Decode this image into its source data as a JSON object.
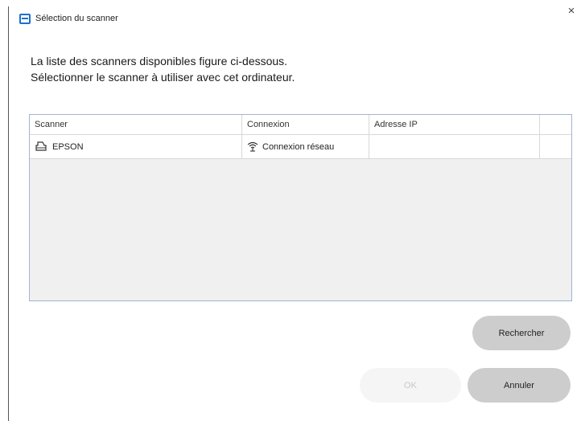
{
  "window": {
    "title": "Sélection du scanner",
    "close_glyph": "×"
  },
  "instructions": {
    "line1": "La liste des scanners disponibles figure ci-dessous.",
    "line2": "Sélectionner le scanner à utiliser avec cet ordinateur."
  },
  "table": {
    "headers": {
      "scanner": "Scanner",
      "connection": "Connexion",
      "ip": "Adresse IP"
    },
    "rows": [
      {
        "scanner": "EPSON",
        "scanner_icon": "printer-icon",
        "connection": "Connexion réseau",
        "connection_icon": "wifi-network-icon",
        "ip": ""
      }
    ]
  },
  "buttons": {
    "search": "Rechercher",
    "ok": "OK",
    "cancel": "Annuler"
  },
  "colors": {
    "accent": "#1f6fcf",
    "button_bg": "#cdcdcd",
    "disabled_button_bg": "#f5f5f5",
    "table_border": "#9fb6cf"
  }
}
